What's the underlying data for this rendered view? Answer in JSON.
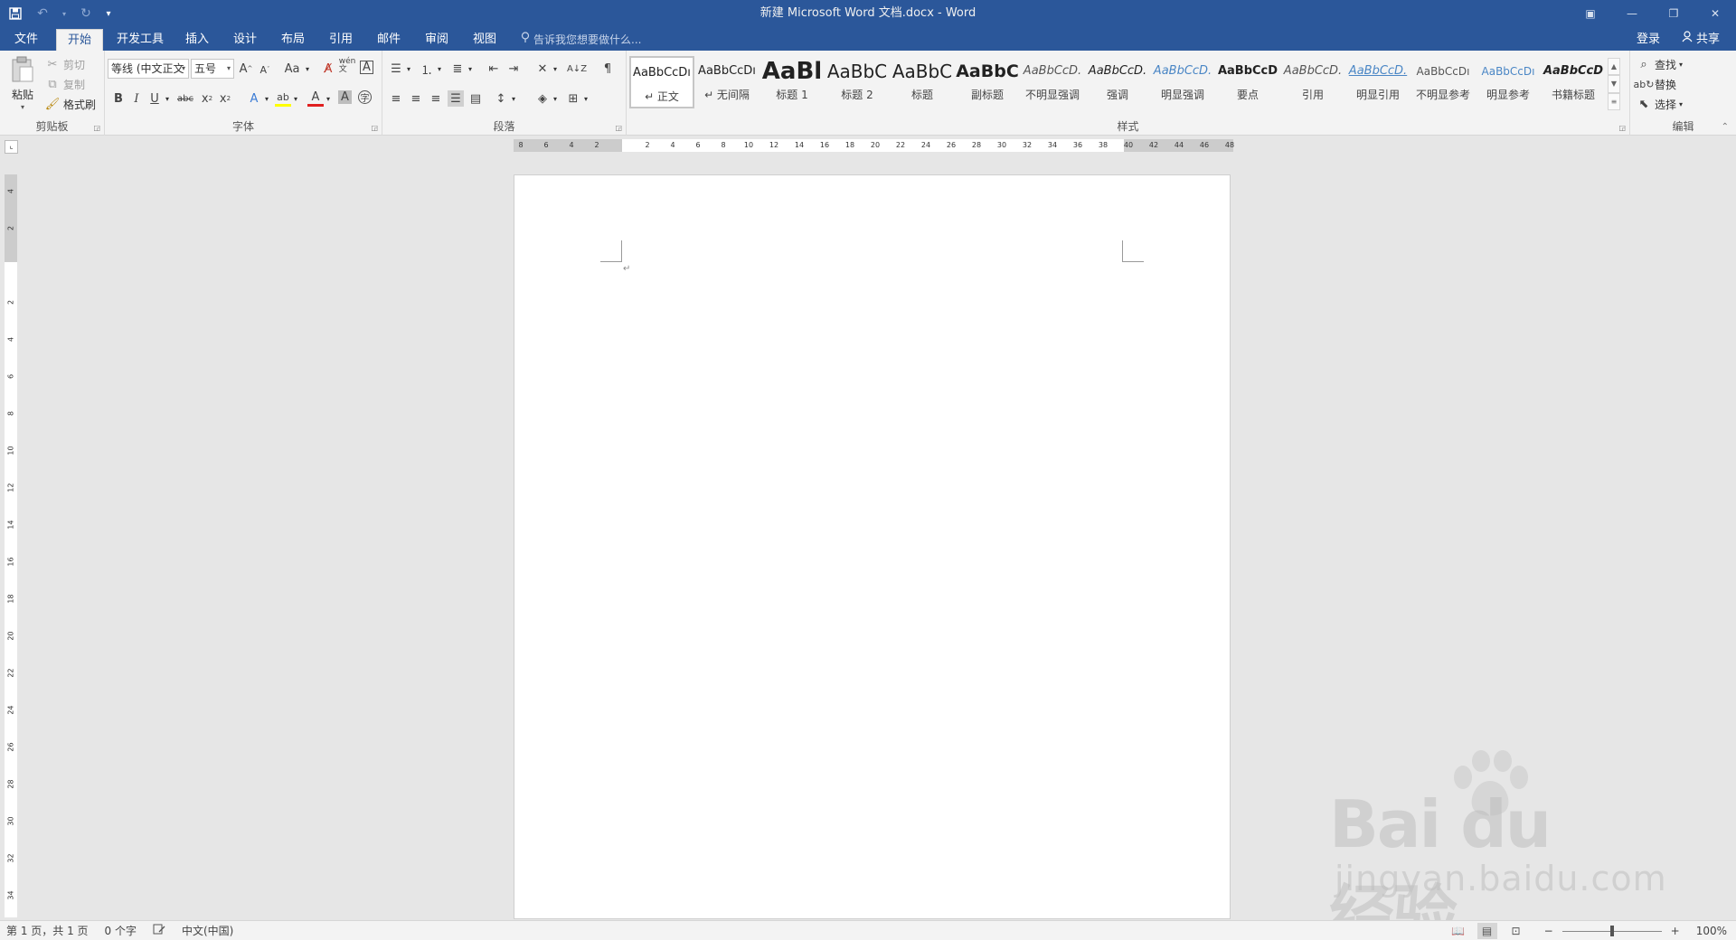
{
  "app": {
    "title": "新建 Microsoft Word 文档.docx - Word",
    "accent_color": "#2b579a",
    "window_controls": {
      "ribbon_options_icon": "ribbon-options-icon",
      "minimize": "—",
      "restore": "❐",
      "close": "✕"
    }
  },
  "qat": {
    "save_icon": "save-icon",
    "undo_icon": "undo-icon",
    "redo_icon": "redo-icon",
    "customize_icon": "customize-icon"
  },
  "tabs": [
    {
      "label": "文件",
      "active": false
    },
    {
      "label": "开始",
      "active": true
    },
    {
      "label": "开发工具",
      "active": false
    },
    {
      "label": "插入",
      "active": false
    },
    {
      "label": "设计",
      "active": false
    },
    {
      "label": "布局",
      "active": false
    },
    {
      "label": "引用",
      "active": false
    },
    {
      "label": "邮件",
      "active": false
    },
    {
      "label": "审阅",
      "active": false
    },
    {
      "label": "视图",
      "active": false
    }
  ],
  "tell_me": "告诉我您想要做什么...",
  "account": {
    "login": "登录",
    "share": "共享"
  },
  "clipboard": {
    "paste": "粘贴",
    "cut": "剪切",
    "copy": "复制",
    "format_painter": "格式刷",
    "group_label": "剪贴板"
  },
  "font": {
    "font_name": "等线 (中文正文",
    "font_size": "五号",
    "group_label": "字体",
    "font_color": "#e02020",
    "highlight_color": "#ffff00"
  },
  "paragraph": {
    "group_label": "段落"
  },
  "styles": {
    "group_label": "样式",
    "items": [
      {
        "preview": "AaBbCcDı",
        "name": "↵ 正文",
        "selected": true
      },
      {
        "preview": "AaBbCcDı",
        "name": "↵ 无间隔",
        "selected": false
      },
      {
        "preview": "AaBl",
        "name": "标题 1",
        "selected": false
      },
      {
        "preview": "AaBbC",
        "name": "标题 2",
        "selected": false
      },
      {
        "preview": "AaBbC",
        "name": "标题",
        "selected": false
      },
      {
        "preview": "AaBbC",
        "name": "副标题",
        "selected": false
      },
      {
        "preview": "AaBbCcD.",
        "name": "不明显强调",
        "selected": false
      },
      {
        "preview": "AaBbCcD.",
        "name": "强调",
        "selected": false
      },
      {
        "preview": "AaBbCcD.",
        "name": "明显强调",
        "selected": false
      },
      {
        "preview": "AaBbCcD",
        "name": "要点",
        "selected": false
      },
      {
        "preview": "AaBbCcD.",
        "name": "引用",
        "selected": false
      },
      {
        "preview": "AaBbCcD.",
        "name": "明显引用",
        "selected": false
      },
      {
        "preview": "AaBbCcDı",
        "name": "不明显参考",
        "selected": false
      },
      {
        "preview": "AaBbCcDı",
        "name": "明显参考",
        "selected": false
      },
      {
        "preview": "AaBbCcD",
        "name": "书籍标题",
        "selected": false
      }
    ]
  },
  "editing": {
    "find": "查找",
    "replace": "替换",
    "select": "选择",
    "group_label": "编辑"
  },
  "ruler": {
    "h_ticks": [
      "8",
      "6",
      "4",
      "2",
      "",
      "2",
      "4",
      "6",
      "8",
      "10",
      "12",
      "14",
      "16",
      "18",
      "20",
      "22",
      "24",
      "26",
      "28",
      "30",
      "32",
      "34",
      "36",
      "38",
      "40",
      "42",
      "44",
      "46",
      "48"
    ],
    "v_ticks": [
      "4",
      "2",
      "",
      "2",
      "4",
      "6",
      "8",
      "10",
      "12",
      "14",
      "16",
      "18",
      "20",
      "22",
      "24",
      "26",
      "28",
      "30",
      "32",
      "34"
    ]
  },
  "statusbar": {
    "page": "第 1 页，共 1 页",
    "words": "0 个字",
    "language": "中文(中国)",
    "zoom": "100%",
    "zoom_minus": "−",
    "zoom_plus": "+"
  },
  "watermark": {
    "brand": "Bai du 经验",
    "url": "jingyan.baidu.com"
  }
}
